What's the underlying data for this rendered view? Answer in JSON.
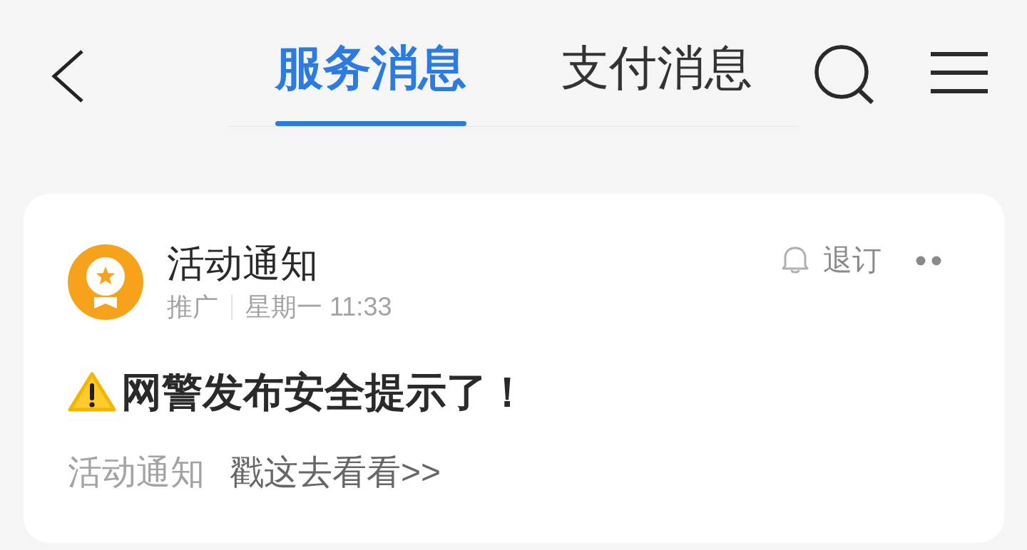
{
  "tabs": [
    {
      "label": "服务消息",
      "selected": true
    },
    {
      "label": "支付消息",
      "selected": false
    }
  ],
  "message": {
    "sender": "活动通知",
    "tag": "推广",
    "time": "星期一 11:33",
    "unsubscribe": "退订",
    "headline": "网警发布安全提示了！",
    "category": "活动通知",
    "link": "戳这去看看>>"
  }
}
